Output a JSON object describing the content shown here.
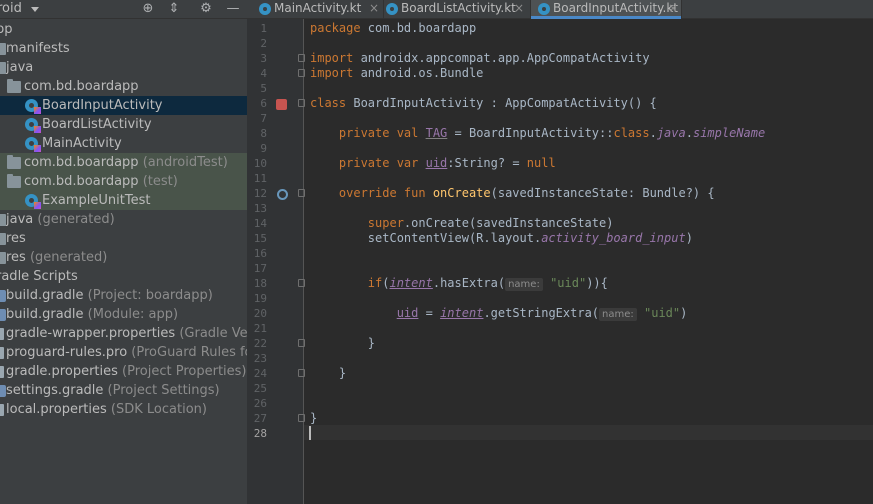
{
  "project_panel": {
    "view_mode": "roid",
    "toolbar_icons": [
      "crosshair-icon",
      "collapse-icon",
      "gear-icon",
      "minimize-icon"
    ],
    "tree": [
      {
        "label": "pp",
        "hint": "",
        "icon": "none"
      },
      {
        "label": "manifests",
        "hint": "",
        "icon": "folder"
      },
      {
        "label": "java",
        "hint": "",
        "icon": "folder"
      },
      {
        "label": "com.bd.boardapp",
        "hint": "",
        "icon": "package"
      },
      {
        "label": "BoardInputActivity",
        "hint": "",
        "icon": "kotlin-class",
        "selected": true
      },
      {
        "label": "BoardListActivity",
        "hint": "",
        "icon": "kotlin-class"
      },
      {
        "label": "MainActivity",
        "hint": "",
        "icon": "kotlin-class"
      },
      {
        "label": "com.bd.boardapp",
        "hint": "(androidTest)",
        "icon": "package"
      },
      {
        "label": "com.bd.boardapp",
        "hint": "(test)",
        "icon": "package"
      },
      {
        "label": "ExampleUnitTest",
        "hint": "",
        "icon": "kotlin-class"
      },
      {
        "label": "java",
        "hint": "(generated)",
        "icon": "folder"
      },
      {
        "label": "res",
        "hint": "",
        "icon": "folder"
      },
      {
        "label": "res",
        "hint": "(generated)",
        "icon": "folder"
      },
      {
        "label": "radle Scripts",
        "hint": "",
        "icon": "none"
      },
      {
        "label": "build.gradle",
        "hint": "(Project: boardapp)",
        "icon": "gradle"
      },
      {
        "label": "build.gradle",
        "hint": "(Module: app)",
        "icon": "gradle"
      },
      {
        "label": "gradle-wrapper.properties",
        "hint": "(Gradle Vers",
        "icon": "properties"
      },
      {
        "label": "proguard-rules.pro",
        "hint": "(ProGuard Rules fo",
        "icon": "properties"
      },
      {
        "label": "gradle.properties",
        "hint": "(Project Properties)",
        "icon": "properties"
      },
      {
        "label": "settings.gradle",
        "hint": "(Project Settings)",
        "icon": "gradle"
      },
      {
        "label": "local.properties",
        "hint": "(SDK Location)",
        "icon": "properties"
      }
    ]
  },
  "tabs": [
    {
      "label": "MainActivity.kt",
      "close": "×"
    },
    {
      "label": "BoardListActivity.kt",
      "close": "×"
    },
    {
      "label": "BoardInputActivity.kt",
      "close": "×",
      "active": true
    }
  ],
  "editor": {
    "line_numbers": [
      "1",
      "2",
      "3",
      "4",
      "5",
      "6",
      "7",
      "8",
      "9",
      "10",
      "11",
      "12",
      "13",
      "14",
      "15",
      "16",
      "17",
      "18",
      "19",
      "20",
      "21",
      "22",
      "23",
      "24",
      "25",
      "26",
      "27",
      "28"
    ],
    "current_line": "28",
    "code": {
      "l1_kw": "package",
      "l1_rest": " com.bd.boardapp",
      "l3_kw": "import",
      "l3_rest": " androidx.appcompat.app.AppCompatActivity",
      "l4_kw": "import",
      "l4_rest": " android.os.Bundle",
      "l6_kw": "class",
      "l6_rest": " BoardInputActivity : AppCompatActivity() {",
      "l8_kw": "private val ",
      "l8_name": "TAG",
      "l8_mid": " = BoardInputActivity::",
      "l8_kw2": "class",
      "l8_dot": ".",
      "l8_java": "java",
      "l8_dot2": ".",
      "l8_simple": "simpleName",
      "l10_kw": "private var ",
      "l10_name": "uid",
      "l10_type": ":String? = ",
      "l10_null": "null",
      "l12_kw": "override fun ",
      "l12_fn": "onCreate",
      "l12_rest": "(savedInstanceState: Bundle?) {",
      "l14_kw": "super",
      "l14_rest": ".onCreate(savedInstanceState)",
      "l15_a": "setContentView(R.layout.",
      "l15_b": "activity_board_input",
      "l15_c": ")",
      "l18_kw": "if",
      "l18_a": "(",
      "l18_intent": "intent",
      "l18_b": ".hasExtra(",
      "l18_hint": "name:",
      "l18_str": "\"uid\"",
      "l18_c": ")){",
      "l20_uid": "uid",
      "l20_a": " = ",
      "l20_intent": "intent",
      "l20_b": ".getStringExtra(",
      "l20_hint": "name:",
      "l20_str": "\"uid\"",
      "l20_c": ")",
      "l22": "}",
      "l24": "}",
      "l27": "}"
    }
  },
  "colors": {
    "background": "#2b2b2b",
    "panel": "#3c3f41",
    "keyword": "#cc7832",
    "function": "#ffc66d",
    "property": "#9876aa",
    "string": "#6a8759",
    "selection": "#0d293e",
    "test_highlight": "#49544a",
    "tab_accent": "#4a88c7"
  }
}
